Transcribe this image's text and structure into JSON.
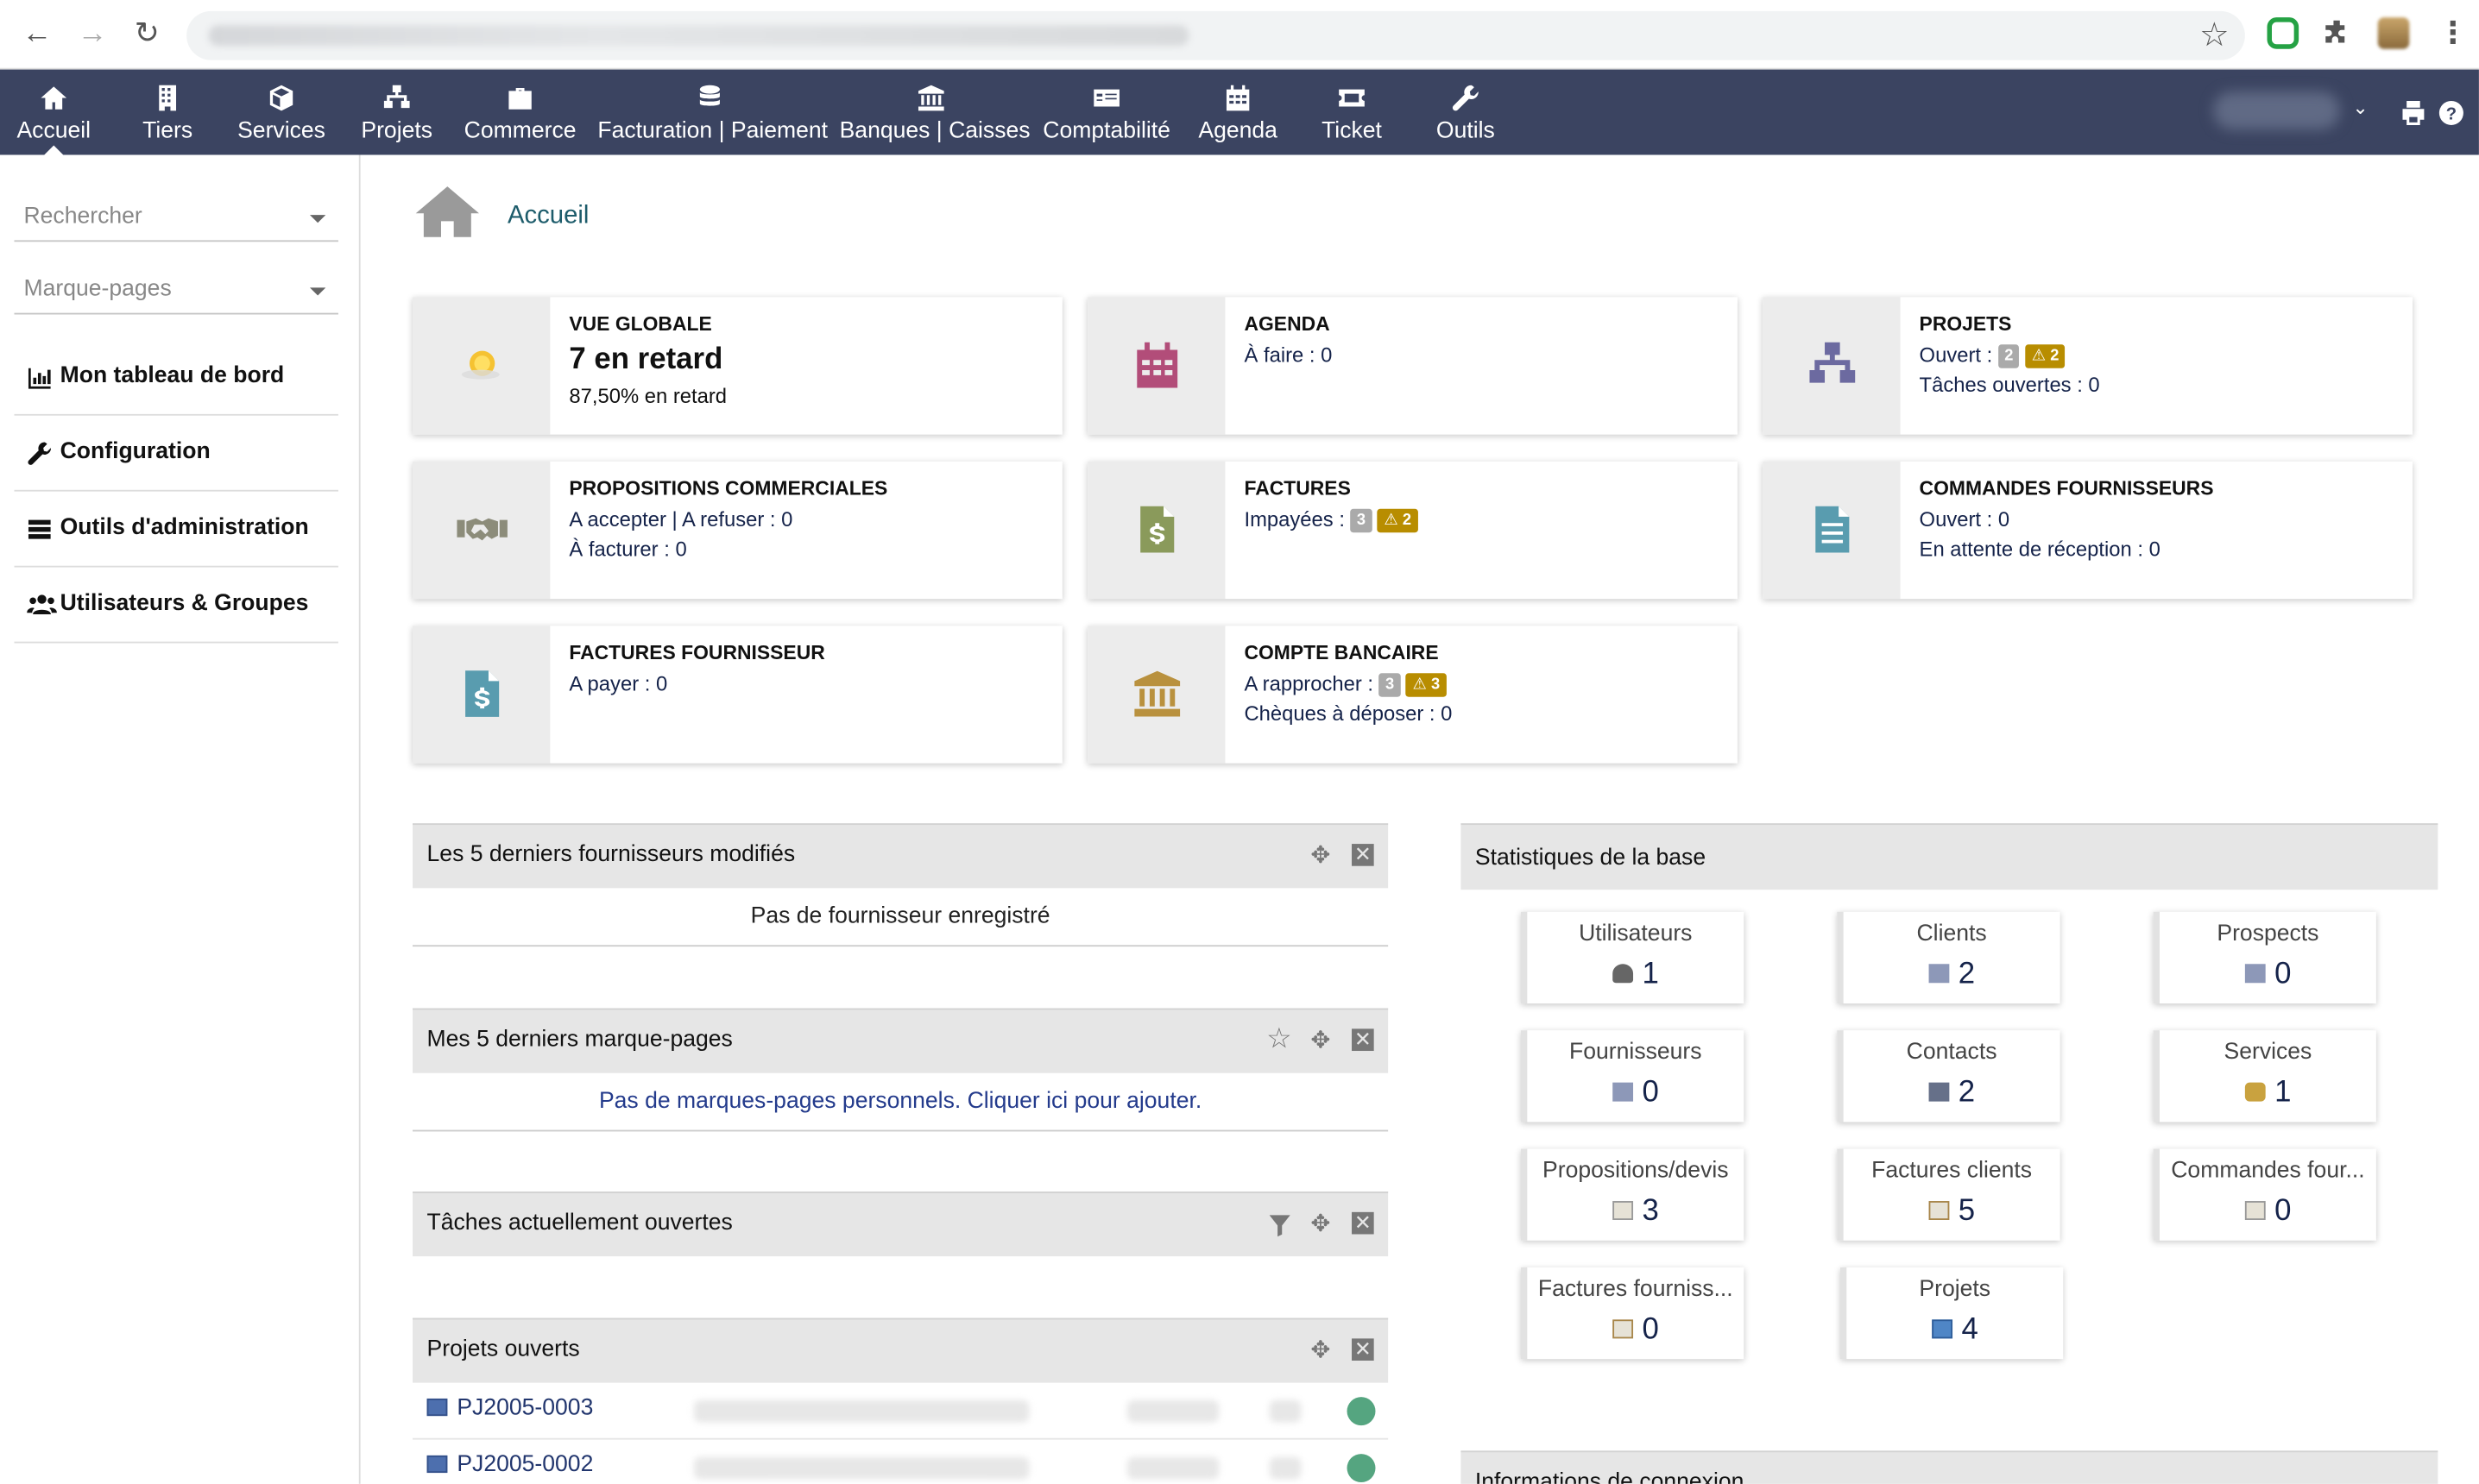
{
  "browser": {
    "back_icon": "arrow-left",
    "forward_icon": "arrow-right",
    "reload_icon": "reload"
  },
  "nav": {
    "items": [
      {
        "label": "Accueil",
        "icon": "home-icon"
      },
      {
        "label": "Tiers",
        "icon": "building-icon"
      },
      {
        "label": "Services",
        "icon": "cube-icon"
      },
      {
        "label": "Projets",
        "icon": "sitemap-icon"
      },
      {
        "label": "Commerce",
        "icon": "briefcase-icon"
      },
      {
        "label": "Facturation | Paiement",
        "icon": "coins-icon"
      },
      {
        "label": "Banques | Caisses",
        "icon": "bank-icon"
      },
      {
        "label": "Comptabilité",
        "icon": "money-check-icon"
      },
      {
        "label": "Agenda",
        "icon": "calendar-icon"
      },
      {
        "label": "Ticket",
        "icon": "ticket-icon"
      },
      {
        "label": "Outils",
        "icon": "wrench-icon"
      }
    ]
  },
  "sidebar": {
    "search_placeholder": "Rechercher",
    "bookmarks_placeholder": "Marque-pages",
    "menu": [
      {
        "label": "Mon tableau de bord",
        "icon": "chart-icon"
      },
      {
        "label": "Configuration",
        "icon": "wrench-icon"
      },
      {
        "label": "Outils d'administration",
        "icon": "server-icon"
      },
      {
        "label": "Utilisateurs & Groupes",
        "icon": "users-icon"
      }
    ]
  },
  "breadcrumb": {
    "title": "Accueil"
  },
  "boxes": {
    "vue_globale": {
      "title": "VUE GLOBALE",
      "big": "7 en retard",
      "sub": "87,50% en retard"
    },
    "agenda": {
      "title": "AGENDA",
      "line1": "À faire : 0"
    },
    "projets": {
      "title": "PROJETS",
      "line1": "Ouvert :",
      "badge1": "2",
      "badge2": "2",
      "line2": "Tâches ouvertes : 0"
    },
    "propositions": {
      "title": "PROPOSITIONS COMMERCIALES",
      "line1": "A accepter | A refuser : 0",
      "line2": "À facturer : 0"
    },
    "factures": {
      "title": "FACTURES",
      "line1": "Impayées :",
      "badge1": "3",
      "badge2": "2"
    },
    "commandes": {
      "title": "COMMANDES FOURNISSEURS",
      "line1": "Ouvert : 0",
      "line2": "En attente de réception : 0"
    },
    "factures_fourn": {
      "title": "FACTURES FOURNISSEUR",
      "line1": "A payer : 0"
    },
    "compte": {
      "title": "COMPTE BANCAIRE",
      "line1": "A rapprocher :",
      "badge1": "3",
      "badge2": "3",
      "line2": "Chèques à déposer : 0"
    }
  },
  "panels": {
    "fournisseurs": {
      "title": "Les 5 derniers fournisseurs modifiés",
      "empty": "Pas de fournisseur enregistré"
    },
    "marque_pages": {
      "title": "Mes 5 derniers marque-pages",
      "empty": "Pas de marques-pages personnels. Cliquer ici pour ajouter."
    },
    "taches": {
      "title": "Tâches actuellement ouvertes"
    },
    "projets": {
      "title": "Projets ouverts",
      "rows": [
        {
          "ref": "PJ2005-0003"
        },
        {
          "ref": "PJ2005-0002"
        }
      ]
    }
  },
  "stats": {
    "title": "Statistiques de la base",
    "items": [
      {
        "label": "Utilisateurs",
        "value": "1",
        "icon": "user-icon"
      },
      {
        "label": "Clients",
        "value": "2",
        "icon": "company-icon"
      },
      {
        "label": "Prospects",
        "value": "0",
        "icon": "company-icon"
      },
      {
        "label": "Fournisseurs",
        "value": "0",
        "icon": "company-icon"
      },
      {
        "label": "Contacts",
        "value": "2",
        "icon": "contact-icon"
      },
      {
        "label": "Services",
        "value": "1",
        "icon": "service-icon"
      },
      {
        "label": "Propositions/devis",
        "value": "3",
        "icon": "document-icon"
      },
      {
        "label": "Factures clients",
        "value": "5",
        "icon": "invoice-icon"
      },
      {
        "label": "Commandes four...",
        "value": "0",
        "icon": "order-icon"
      },
      {
        "label": "Factures fourniss...",
        "value": "0",
        "icon": "invoice-icon"
      },
      {
        "label": "Projets",
        "value": "4",
        "icon": "project-icon"
      }
    ]
  },
  "connexion": {
    "title": "Informations de connexion"
  },
  "colors": {
    "nav_bg": "#3b4461",
    "link": "#15234a",
    "warning": "#b88d00",
    "status_ok": "#55a580"
  }
}
